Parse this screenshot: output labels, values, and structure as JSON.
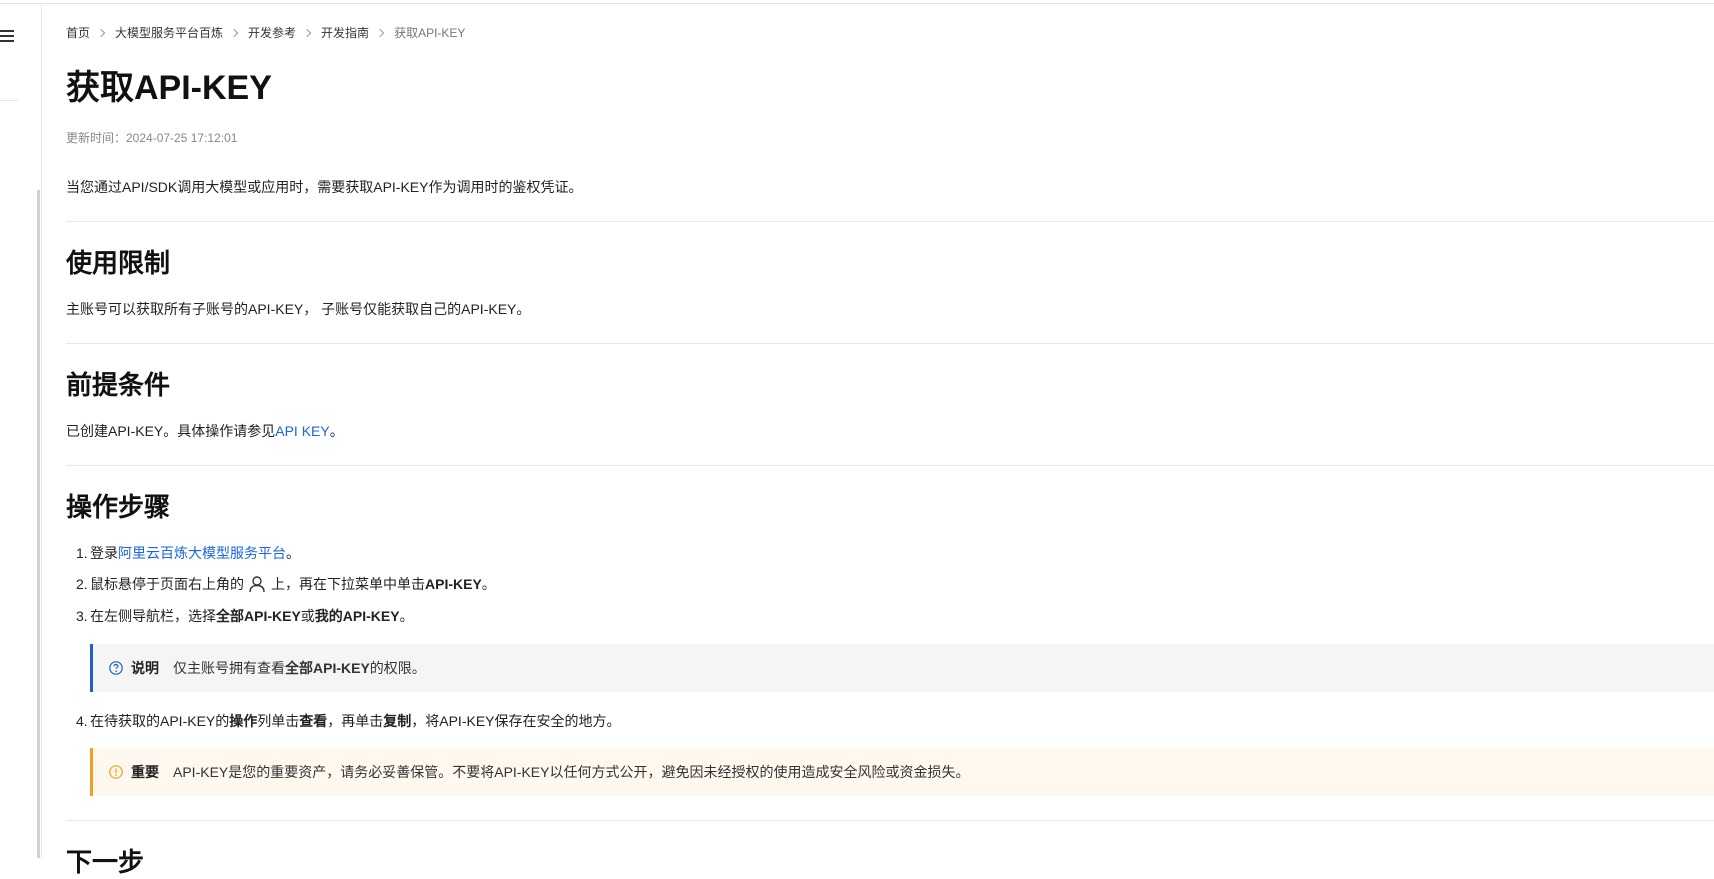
{
  "breadcrumb": [
    "首页",
    "大模型服务平台百炼",
    "开发参考",
    "开发指南",
    "获取API-KEY"
  ],
  "page": {
    "title": "获取API-KEY",
    "update_time": "更新时间：2024-07-25 17:12:01",
    "intro": "当您通过API/SDK调用大模型或应用时，需要获取API-KEY作为调用时的鉴权凭证。"
  },
  "sections": {
    "usage_limit": {
      "heading": "使用限制",
      "text": "主账号可以获取所有子账号的API-KEY， 子账号仅能获取自己的API-KEY。"
    },
    "prerequisite": {
      "heading": "前提条件",
      "text_before": "已创建API-KEY。具体操作请参见",
      "link": "API KEY",
      "text_after": "。"
    },
    "steps": {
      "heading": "操作步骤",
      "step1": {
        "num": "1.",
        "text_before": "登录",
        "link": "阿里云百炼大模型服务平台",
        "text_after": "。"
      },
      "step2": {
        "num": "2.",
        "text_before": "鼠标悬停于页面右上角的",
        "text_mid": "上，再在下拉菜单中单击",
        "bold": "API-KEY",
        "text_after": "。"
      },
      "step3": {
        "num": "3.",
        "text_before": "在左侧导航栏，选择",
        "bold1": "全部API-KEY",
        "text_mid": "或",
        "bold2": "我的API-KEY",
        "text_after": "。"
      },
      "note": {
        "label": "说明",
        "text_before": "仅主账号拥有查看",
        "bold": "全部API-KEY",
        "text_after": "的权限。"
      },
      "step4": {
        "num": "4.",
        "text_before": "在待获取的API-KEY的",
        "bold1": "操作",
        "text_mid1": "列单击",
        "bold2": "查看",
        "text_mid2": "，再单击",
        "bold3": "复制",
        "text_after": "，将API-KEY保存在安全的地方。"
      },
      "warning": {
        "label": "重要",
        "text": "API-KEY是您的重要资产，请务必妥善保管。不要将API-KEY以任何方式公开，避免因未经授权的使用造成安全风险或资金损失。"
      }
    },
    "next": {
      "heading": "下一步"
    }
  },
  "icons": {
    "menu": "hamburger-icon",
    "user": "user-icon",
    "note": "question-circle-icon",
    "warning": "exclamation-circle-icon"
  },
  "colors": {
    "link": "#1a66e0",
    "note_accent": "#1f5fc7",
    "warning_accent": "#f0a020"
  }
}
